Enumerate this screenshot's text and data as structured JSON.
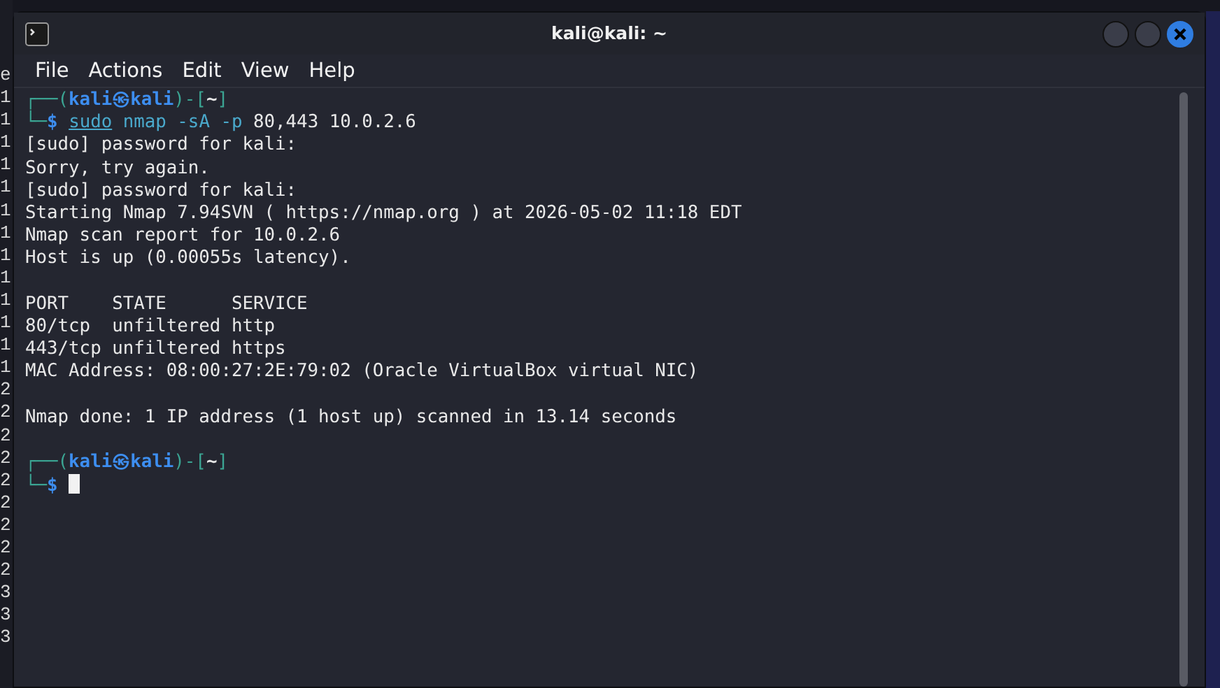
{
  "window": {
    "title": "kali@kali: ~",
    "menu": [
      "File",
      "Actions",
      "Edit",
      "View",
      "Help"
    ]
  },
  "terminal": {
    "lines": [
      {
        "kind": "prompt",
        "segments": [
          {
            "kind": "frame",
            "text": "┌──("
          },
          {
            "kind": "identity",
            "text": "kali㉿kali"
          },
          {
            "kind": "frame",
            "text": ")-["
          },
          {
            "kind": "path",
            "text": "~"
          },
          {
            "kind": "frame",
            "text": "]"
          }
        ]
      },
      {
        "kind": "command",
        "segments": [
          {
            "kind": "frame",
            "text": "└─"
          },
          {
            "kind": "dollar",
            "text": "$ "
          },
          {
            "kind": "command",
            "text": "sudo"
          },
          {
            "kind": "program",
            "text": " nmap -sA -p"
          },
          {
            "kind": "argument",
            "text": " 80,443 10.0.2.6"
          }
        ]
      },
      {
        "kind": "output",
        "text": "[sudo] password for kali:"
      },
      {
        "kind": "output",
        "text": "Sorry, try again."
      },
      {
        "kind": "output",
        "text": "[sudo] password for kali:"
      },
      {
        "kind": "output",
        "text": "Starting Nmap 7.94SVN ( https://nmap.org ) at 2026-05-02 11:18 EDT"
      },
      {
        "kind": "output",
        "text": "Nmap scan report for 10.0.2.6"
      },
      {
        "kind": "output",
        "text": "Host is up (0.00055s latency)."
      },
      {
        "kind": "blank"
      },
      {
        "kind": "output",
        "text": "PORT    STATE      SERVICE"
      },
      {
        "kind": "output",
        "text": "80/tcp  unfiltered http"
      },
      {
        "kind": "output",
        "text": "443/tcp unfiltered https"
      },
      {
        "kind": "output",
        "text": "MAC Address: 08:00:27:2E:79:02 (Oracle VirtualBox virtual NIC)"
      },
      {
        "kind": "blank"
      },
      {
        "kind": "output",
        "text": "Nmap done: 1 IP address (1 host up) scanned in 13.14 seconds"
      },
      {
        "kind": "blank"
      },
      {
        "kind": "prompt",
        "segments": [
          {
            "kind": "frame",
            "text": "┌──("
          },
          {
            "kind": "identity",
            "text": "kali㉿kali"
          },
          {
            "kind": "frame",
            "text": ")-["
          },
          {
            "kind": "path",
            "text": "~"
          },
          {
            "kind": "frame",
            "text": "]"
          }
        ]
      },
      {
        "kind": "command",
        "cursor": true,
        "segments": [
          {
            "kind": "frame",
            "text": "└─"
          },
          {
            "kind": "dollar",
            "text": "$ "
          }
        ]
      }
    ]
  },
  "background_window": {
    "line_starts": [
      "e",
      "1",
      "1",
      "1",
      "1",
      "1",
      "1",
      "1",
      "1",
      "1",
      "1",
      "1",
      "1",
      "1",
      "2",
      "2",
      "2",
      "2",
      "2",
      "2",
      "2",
      "2",
      "2",
      "3",
      "3",
      "3"
    ]
  }
}
